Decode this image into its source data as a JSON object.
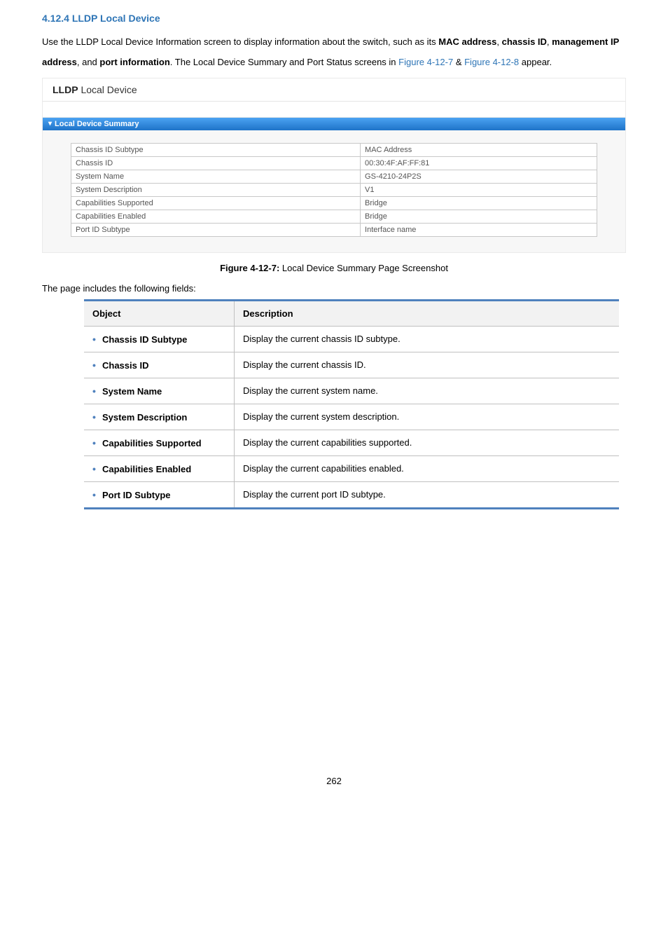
{
  "heading": "4.12.4 LLDP Local Device",
  "intro": {
    "pre": "Use the LLDP Local Device Information screen to display information about the switch, such as its ",
    "b1": "MAC address",
    "c1": ", ",
    "b2": "chassis ID",
    "c2": ", ",
    "b3": "management IP address",
    "c3": ", and ",
    "b4": "port information",
    "post1": ". The Local Device Summary and Port Status screens in ",
    "link1": "Figure 4-12-7",
    "amp": " & ",
    "link2": "Figure 4-12-8",
    "post2": " appear."
  },
  "panel": {
    "title_bold": "LLDP",
    "title_rest": " Local Device",
    "section_label": "Local Device Summary"
  },
  "summary_rows": [
    {
      "k": "Chassis ID Subtype",
      "v": "MAC Address"
    },
    {
      "k": "Chassis ID",
      "v": "00:30:4F:AF:FF:81"
    },
    {
      "k": "System Name",
      "v": "GS-4210-24P2S"
    },
    {
      "k": "System Description",
      "v": "V1"
    },
    {
      "k": "Capabilities Supported",
      "v": "Bridge"
    },
    {
      "k": "Capabilities Enabled",
      "v": "Bridge"
    },
    {
      "k": "Port ID Subtype",
      "v": "Interface name"
    }
  ],
  "figure_caption_bold": "Figure 4-12-7:",
  "figure_caption_rest": " Local Device Summary Page Screenshot",
  "fields_intro": "The page includes the following fields:",
  "fields_header_object": "Object",
  "fields_header_desc": "Description",
  "fields": [
    {
      "obj": "Chassis ID Subtype",
      "desc": "Display the current chassis ID subtype."
    },
    {
      "obj": "Chassis ID",
      "desc": "Display the current chassis ID."
    },
    {
      "obj": "System Name",
      "desc": "Display the current system name."
    },
    {
      "obj": "System Description",
      "desc": "Display the current system description."
    },
    {
      "obj": "Capabilities Supported",
      "desc": "Display the current capabilities supported."
    },
    {
      "obj": "Capabilities Enabled",
      "desc": "Display the current capabilities enabled."
    },
    {
      "obj": "Port ID Subtype",
      "desc": "Display the current port ID subtype."
    }
  ],
  "page_number": "262"
}
